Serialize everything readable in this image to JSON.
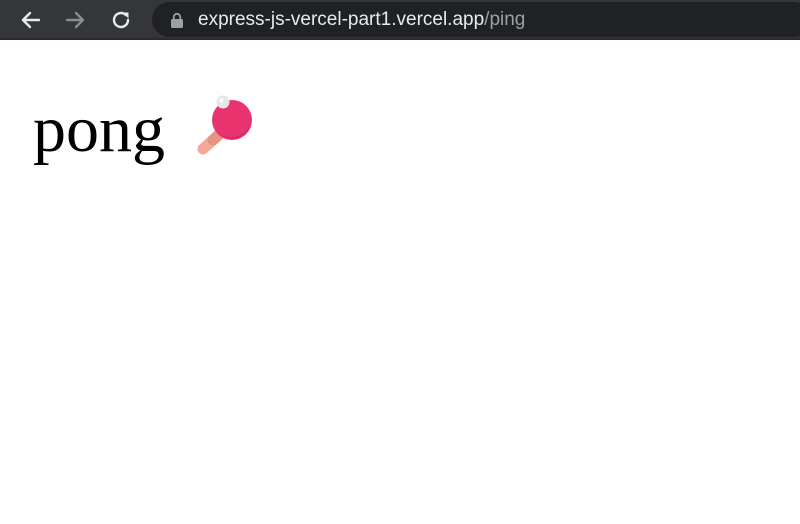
{
  "browser": {
    "url_host": "express-js-vercel-part1.vercel.app",
    "url_path": "/ping",
    "icons": {
      "back": "back-arrow-icon",
      "forward": "forward-arrow-icon",
      "reload": "reload-icon",
      "lock": "lock-icon"
    },
    "colors": {
      "toolbar": "#35363a",
      "omnibox": "#202124",
      "url_host": "#e8eaed",
      "url_path": "#9aa0a6"
    }
  },
  "page": {
    "text": "pong",
    "emoji_icon": "ping-pong-paddle-icon",
    "colors": {
      "paddle_red": "#e8336e",
      "paddle_handle": "#f3a99a",
      "ball": "#e6e6e6"
    }
  }
}
